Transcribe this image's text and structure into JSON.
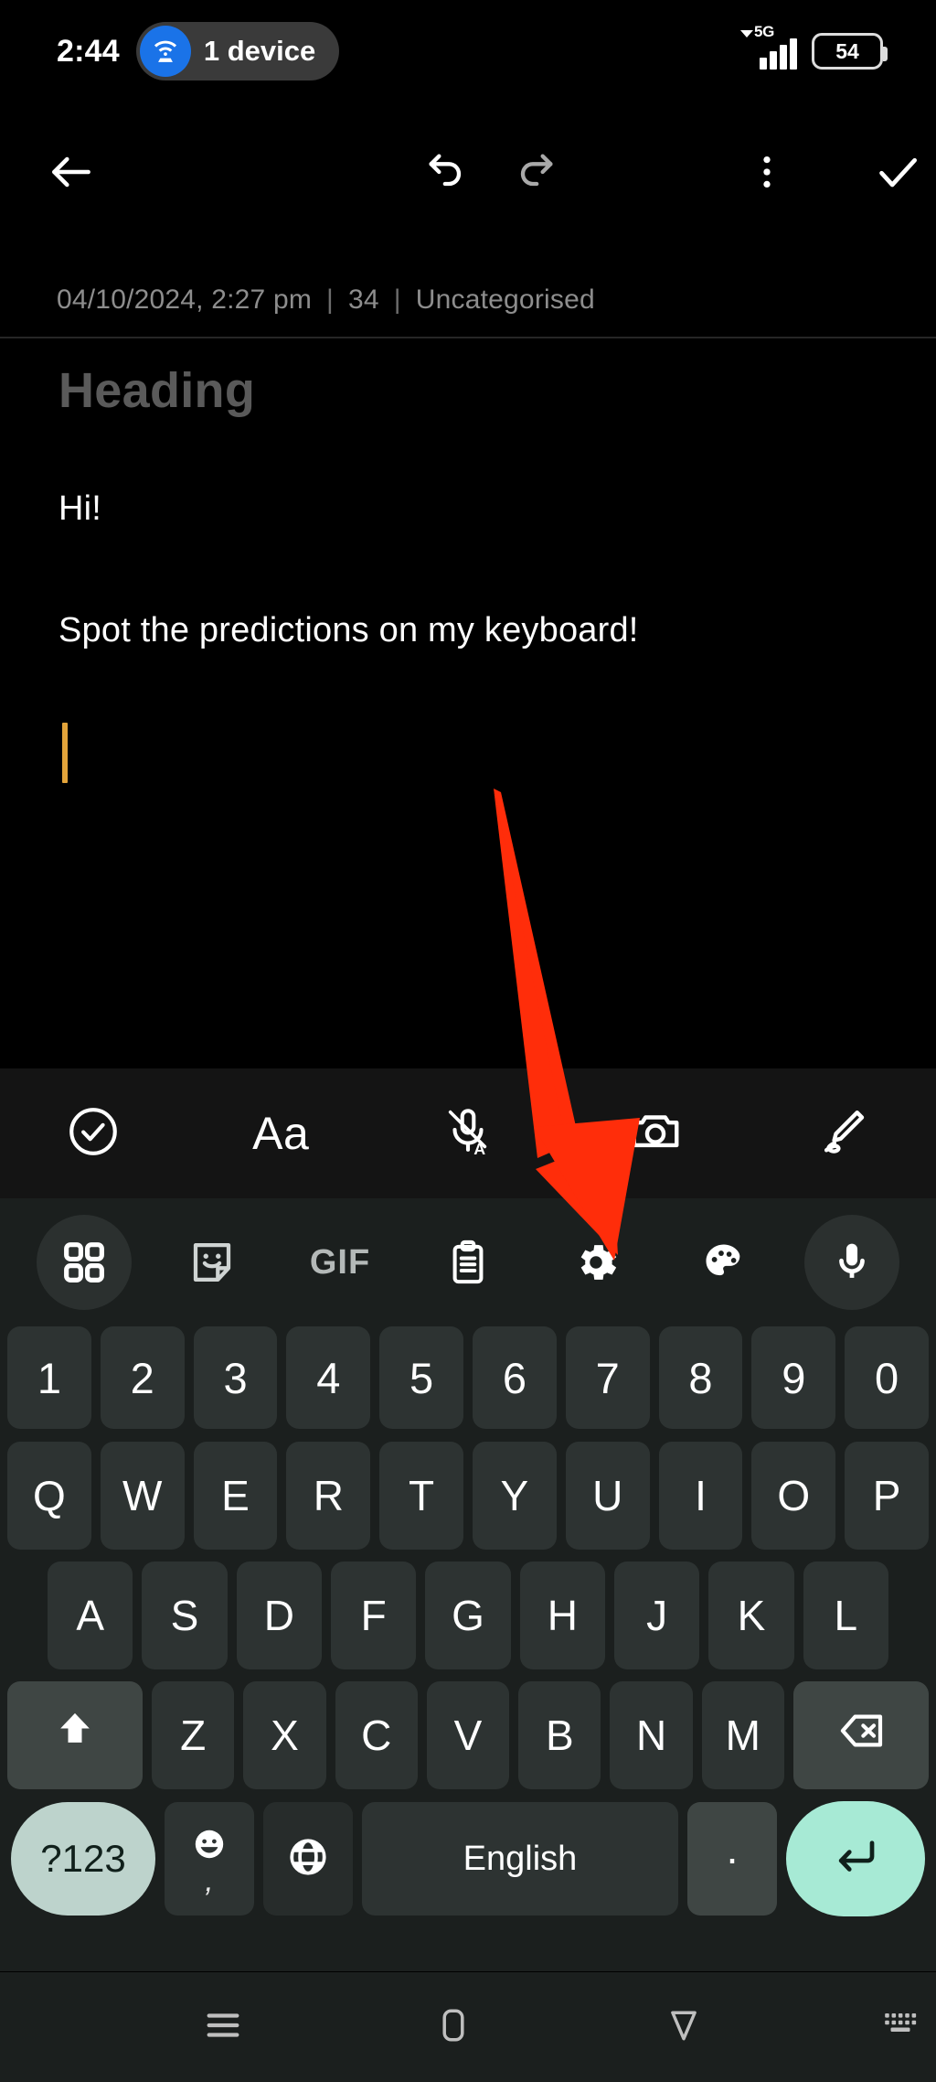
{
  "status_bar": {
    "time": "2:44",
    "hotspot_icon": "wifi-hotspot-icon",
    "hotspot_label": "1 device",
    "network_type": "5G",
    "signal_icon": "signal-bars-icon",
    "battery_level": "54"
  },
  "app_toolbar": {
    "back_icon": "back-arrow-icon",
    "undo_icon": "undo-icon",
    "redo_icon": "redo-icon",
    "more_icon": "overflow-menu-icon",
    "done_icon": "checkmark-icon"
  },
  "note_meta": {
    "timestamp": "04/10/2024, 2:27 pm",
    "separator": "|",
    "char_count": "34",
    "category": "Uncategorised"
  },
  "note": {
    "title_placeholder": "Heading",
    "paragraphs": [
      "Hi!",
      "Spot the predictions on my keyboard!"
    ],
    "caret_color": "#e3a43a"
  },
  "accessory_bar": {
    "items": [
      {
        "icon": "checklist-circle-icon",
        "label": ""
      },
      {
        "icon": "text-format-icon",
        "label": "Aa"
      },
      {
        "icon": "voice-input-icon",
        "label": ""
      },
      {
        "icon": "camera-icon",
        "label": ""
      },
      {
        "icon": "draw-pen-icon",
        "label": ""
      }
    ]
  },
  "keyboard": {
    "toolbar": [
      {
        "icon": "apps-grid-icon",
        "label": "",
        "highlighted": true
      },
      {
        "icon": "sticker-icon",
        "label": "",
        "highlighted": false
      },
      {
        "icon": "gif-icon",
        "label": "GIF",
        "highlighted": false
      },
      {
        "icon": "clipboard-icon",
        "label": "",
        "highlighted": false
      },
      {
        "icon": "settings-gear-icon",
        "label": "",
        "highlighted": false
      },
      {
        "icon": "theme-palette-icon",
        "label": "",
        "highlighted": false
      },
      {
        "icon": "microphone-icon",
        "label": "",
        "highlighted": true
      }
    ],
    "number_row": [
      "1",
      "2",
      "3",
      "4",
      "5",
      "6",
      "7",
      "8",
      "9",
      "0"
    ],
    "row_top": [
      "Q",
      "W",
      "E",
      "R",
      "T",
      "Y",
      "U",
      "I",
      "O",
      "P"
    ],
    "row_home": [
      "A",
      "S",
      "D",
      "F",
      "G",
      "H",
      "J",
      "K",
      "L"
    ],
    "row_bottom": [
      "Z",
      "X",
      "C",
      "V",
      "B",
      "N",
      "M"
    ],
    "shift_icon": "shift-arrow-icon",
    "backspace_icon": "backspace-icon",
    "symbols_label": "?123",
    "emoji_icon": "emoji-smiley-icon",
    "comma_label": ",",
    "globe_icon": "language-globe-icon",
    "space_label": "English",
    "period_label": ".",
    "enter_icon": "enter-return-icon",
    "accent_color": "#a7ead5",
    "symbols_key_color": "#bdd3cc"
  },
  "nav_bar": {
    "recents_icon": "recents-icon",
    "home_icon": "home-icon",
    "back_icon": "nav-back-triangle-icon",
    "hide_keyboard_icon": "hide-keyboard-icon"
  },
  "annotation": {
    "arrow_icon": "red-pointer-arrow",
    "arrow_color": "#FF2D0A",
    "points_at": "settings-gear-icon"
  }
}
